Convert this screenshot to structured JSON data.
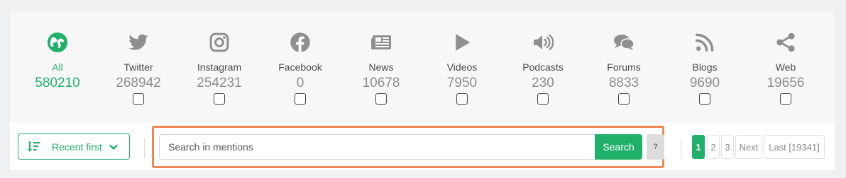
{
  "sources": [
    {
      "label": "All",
      "count": "580210",
      "icon": "globe-icon",
      "active": true
    },
    {
      "label": "Twitter",
      "count": "268942",
      "icon": "twitter-icon"
    },
    {
      "label": "Instagram",
      "count": "254231",
      "icon": "instagram-icon"
    },
    {
      "label": "Facebook",
      "count": "0",
      "icon": "facebook-icon"
    },
    {
      "label": "News",
      "count": "10678",
      "icon": "newspaper-icon"
    },
    {
      "label": "Videos",
      "count": "7950",
      "icon": "play-icon"
    },
    {
      "label": "Podcasts",
      "count": "230",
      "icon": "speaker-icon"
    },
    {
      "label": "Forums",
      "count": "8833",
      "icon": "chat-bubbles-icon"
    },
    {
      "label": "Blogs",
      "count": "9690",
      "icon": "rss-icon"
    },
    {
      "label": "Web",
      "count": "19656",
      "icon": "share-icon"
    }
  ],
  "sort": {
    "label": "Recent first"
  },
  "search": {
    "placeholder": "Search in mentions",
    "button": "Search",
    "help": "?"
  },
  "pagination": {
    "pages": [
      "1",
      "2",
      "3"
    ],
    "current": "1",
    "next": "Next",
    "last": "Last [19341]"
  },
  "colors": {
    "accent": "#21b06a",
    "icon_gray": "#8f8f8f",
    "highlight": "#f08855"
  }
}
